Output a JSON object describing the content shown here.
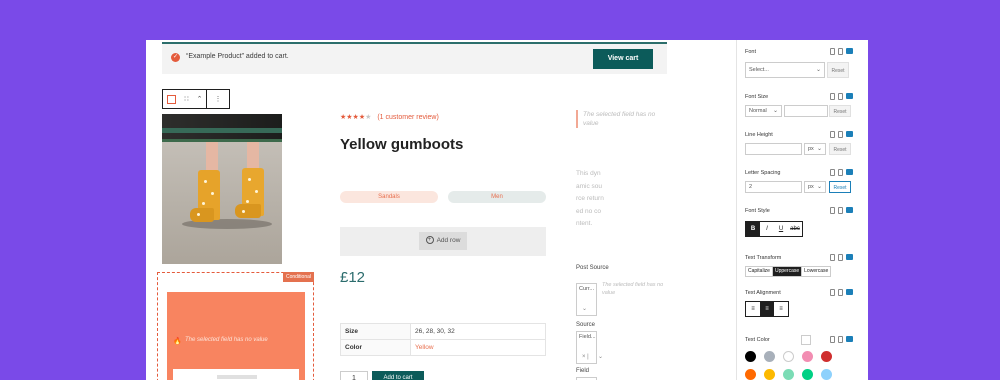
{
  "notice": {
    "message": "“Example Product” added to cart.",
    "view_cart": "View cart"
  },
  "toolbar": {
    "drag": "∷",
    "move": "⌃",
    "more": "⋮"
  },
  "conditional": {
    "tag": "Conditional",
    "empty_text": "The selected field has no value"
  },
  "product": {
    "stars_filled": "★★★★",
    "stars_empty": "★",
    "rating": 4,
    "review_link": "(1 customer review)",
    "title": "Yellow gumboots",
    "tags": [
      "Sandals",
      "Men"
    ],
    "add_row": "Add row",
    "price": "£12",
    "attributes": [
      {
        "key": "Size",
        "value": "26, 28, 30, 32"
      },
      {
        "key": "Color",
        "value": "Yellow"
      }
    ],
    "quantity": "1",
    "add_to_cart": "Add to cart"
  },
  "right_col": {
    "selected_note": "The selected field has no value",
    "dynamic_text": "This dynamic source returned no content.",
    "post_source_label": "Post Source",
    "post_source_value": "Curr...",
    "selected_note_2": "The selected field has no value",
    "source_label": "Source",
    "source_value": "Field...",
    "field_label": "Field"
  },
  "sidebar": {
    "font": {
      "label": "Font",
      "placeholder": "Select...",
      "reset": "Reset"
    },
    "font_size": {
      "label": "Font Size",
      "value": "Normal",
      "reset": "Reset"
    },
    "line_height": {
      "label": "Line Height",
      "unit": "px",
      "reset": "Reset"
    },
    "letter_spacing": {
      "label": "Letter Spacing",
      "value": "2",
      "unit": "px",
      "reset": "Reset"
    },
    "font_style": {
      "label": "Font Style",
      "buttons": [
        "B",
        "I",
        "U",
        "abc"
      ]
    },
    "text_transform": {
      "label": "Text Transform",
      "options": [
        "Capitalize",
        "Uppercase",
        "Lowercase"
      ],
      "selected": "Uppercase"
    },
    "text_alignment": {
      "label": "Text Alignment",
      "options": [
        "left",
        "center",
        "right"
      ],
      "selected": "center"
    },
    "text_color": {
      "label": "Text Color",
      "swatches": [
        "#000000",
        "#a8b0ba",
        "#ffffff",
        "#f28db2",
        "#cf2e2e",
        "#ff6900",
        "#fcb900",
        "#7bdcb5",
        "#00d084",
        "#8ed1fc"
      ]
    }
  },
  "colors": {
    "background": "#7a4ae8",
    "accent": "#0c5b5a",
    "orange": "#e45b3c"
  }
}
